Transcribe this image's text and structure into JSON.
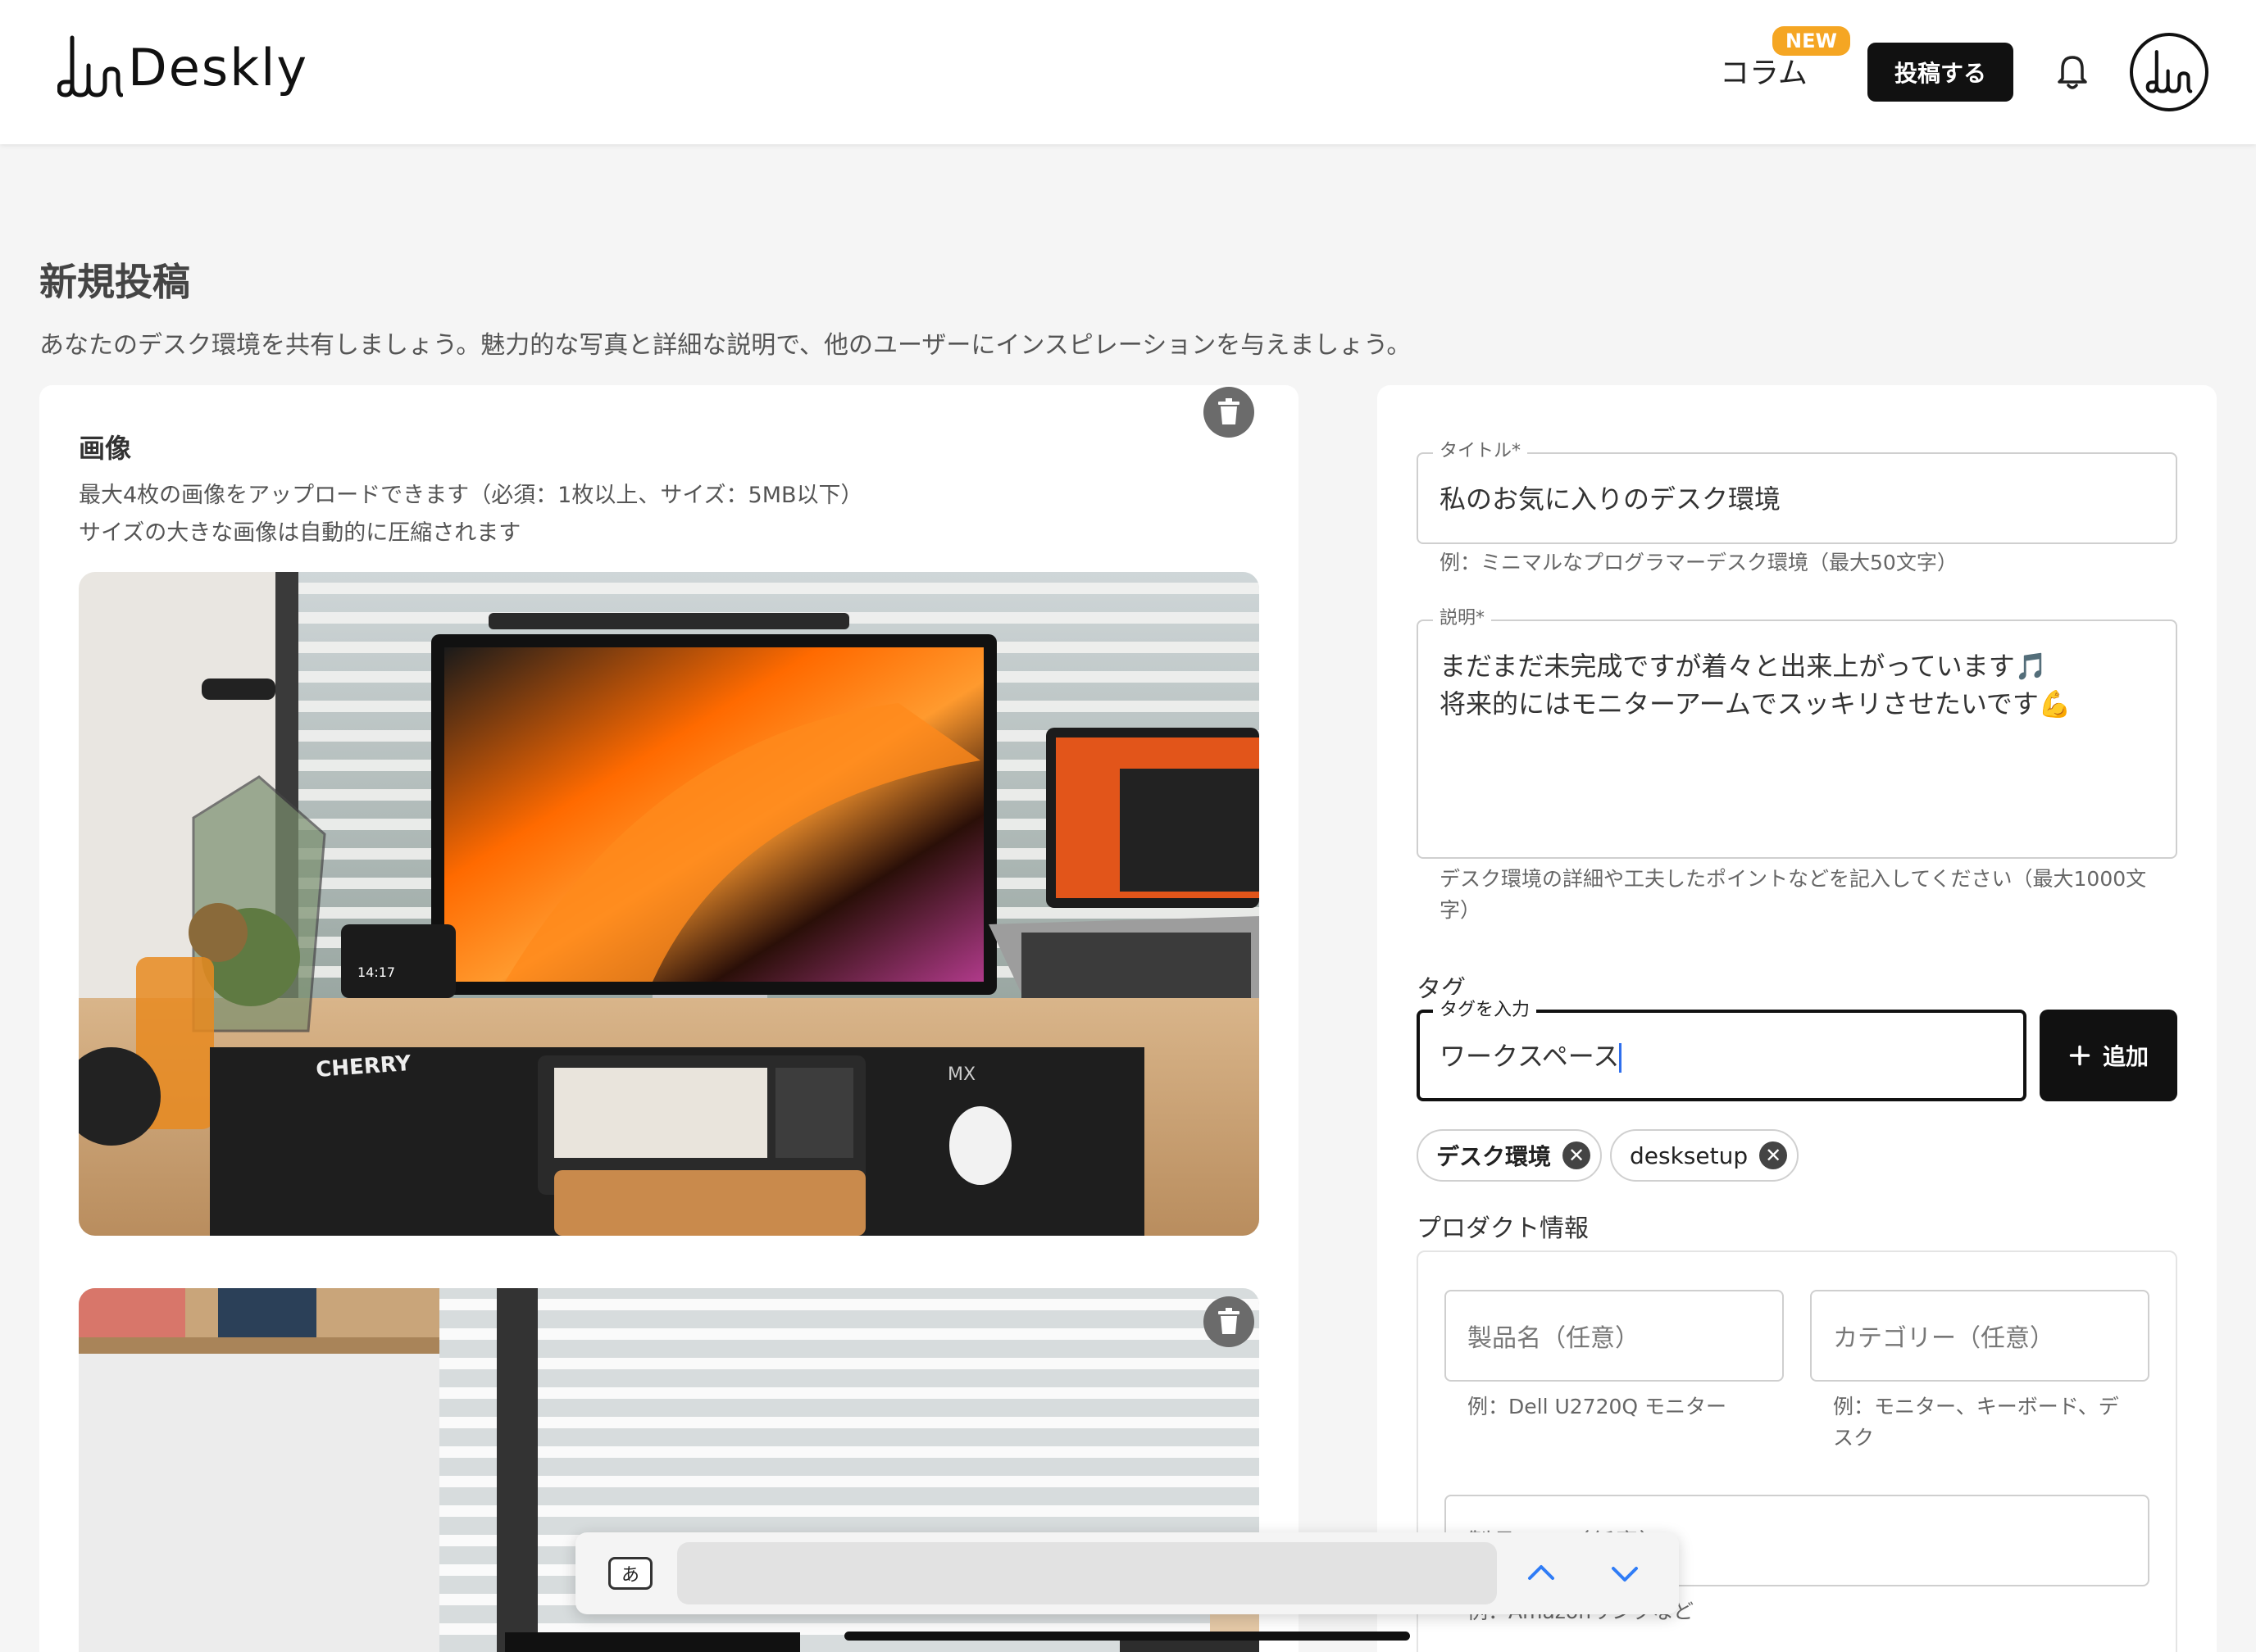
{
  "header": {
    "logo_text": "Deskly",
    "nav_column": "コラム",
    "new_badge": "NEW",
    "post_button": "投稿する",
    "bell_icon": "bell-icon",
    "avatar_icon": "logo-avatar"
  },
  "page": {
    "title": "新規投稿",
    "subtitle": "あなたのデスク環境を共有しましょう。魅力的な写真と詳細な説明で、他のユーザーにインスピレーションを与えましょう。"
  },
  "images_section": {
    "title": "画像",
    "desc_line1": "最大4枚の画像をアップロードできます（必須：1枚以上、サイズ：5MB以下）",
    "desc_line2": "サイズの大きな画像は自動的に圧縮されます",
    "screen_time": "14:17",
    "keyboard_brand": "CHERRY",
    "mousepad_brand": "MX",
    "delete_icon": "trash-icon"
  },
  "form": {
    "title_label": "タイトル*",
    "title_value": "私のお気に入りのデスク環境",
    "title_helper": "例：ミニマルなプログラマーデスク環境（最大50文字）",
    "desc_label": "説明*",
    "desc_line1": "まだまだ未完成ですが着々と出来上がっています🎵",
    "desc_line2": "将来的にはモニターアームでスッキリさせたいです💪",
    "desc_helper_line1": "デスク環境の詳細や工夫したポイントなどを記入してください（最大1000文",
    "desc_helper_line2": "字）",
    "tags_heading": "タグ",
    "tag_input_label": "タグを入力",
    "tag_input_value": "ワークスペース",
    "add_button": "追加",
    "tags": [
      "デスク環境",
      "desksetup"
    ],
    "product_heading": "プロダクト情報",
    "product_name_placeholder": "製品名（任意）",
    "product_name_helper": "例：Dell U2720Q モニター",
    "category_placeholder": "カテゴリー（任意）",
    "category_helper_line1": "例：モニター、キーボード、デ",
    "category_helper_line2": "スク",
    "url_placeholder": "製品URL（任意）",
    "url_helper": "例：Amazonリンクなど"
  },
  "findbar": {
    "ime_key": "あ",
    "up_icon": "chevron-up-icon",
    "down_icon": "chevron-down-icon"
  },
  "colors": {
    "accent_badge": "#f5a623",
    "primary": "#111111",
    "background": "#f5f5f5"
  }
}
